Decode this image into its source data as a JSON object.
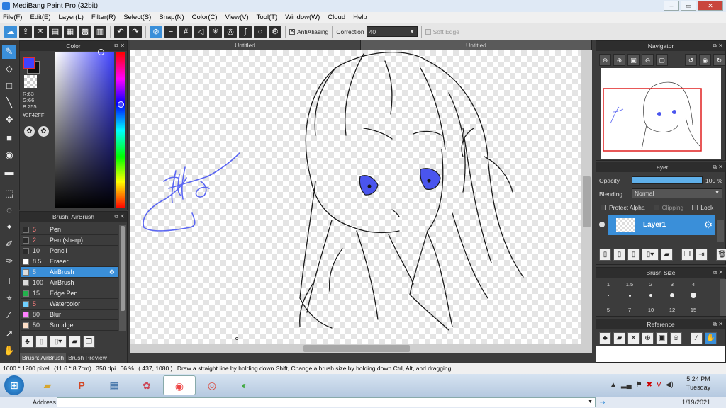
{
  "window": {
    "title": "MediBang Paint Pro (32bit)",
    "minimize": "–",
    "maximize": "▭",
    "close": "✕"
  },
  "menu": [
    "File(F)",
    "Edit(E)",
    "Layer(L)",
    "Filter(R)",
    "Select(S)",
    "Snap(N)",
    "Color(C)",
    "View(V)",
    "Tool(T)",
    "Window(W)",
    "Cloud",
    "Help"
  ],
  "toolbar": {
    "antialiasing": "AntiAliasing",
    "correction_label": "Correction",
    "correction_value": "40",
    "soft_edge": "Soft Edge"
  },
  "color_panel": {
    "title": "Color",
    "r": "R:63",
    "g": "G:66",
    "b": "B:255",
    "hex": "#3F42FF",
    "main_color": "#3F42FF"
  },
  "brush_panel": {
    "title": "Brush: AirBrush",
    "brushes": [
      {
        "size": "5",
        "name": "Pen",
        "swatch": "#2b2b2b",
        "selected": false
      },
      {
        "size": "2",
        "name": "Pen (sharp)",
        "swatch": "#2b2b2b",
        "selected": false
      },
      {
        "size": "10",
        "name": "Pencil",
        "swatch": "#2b2b2b",
        "selected": false
      },
      {
        "size": "8.5",
        "name": "Eraser",
        "swatch": "#ffffff",
        "selected": false
      },
      {
        "size": "5",
        "name": "AirBrush",
        "swatch": "#dddddd",
        "selected": true
      },
      {
        "size": "100",
        "name": "AirBrush",
        "swatch": "#dddddd",
        "selected": false
      },
      {
        "size": "15",
        "name": "Edge Pen",
        "swatch": "#22b14c",
        "selected": false
      },
      {
        "size": "5",
        "name": "Watercolor",
        "swatch": "#6fd0ff",
        "selected": false
      },
      {
        "size": "80",
        "name": "Blur",
        "swatch": "#ff80ff",
        "selected": false
      },
      {
        "size": "50",
        "name": "Smudge",
        "swatch": "#ffe0c8",
        "selected": false
      }
    ],
    "tab_active": "Brush: AirBrush",
    "tab_inactive": "Brush Preview"
  },
  "tabs": [
    "Untitled",
    "Untitled"
  ],
  "navigator": {
    "title": "Navigator"
  },
  "layer_panel": {
    "title": "Layer",
    "opacity_label": "Opacity",
    "opacity_value": "100 %",
    "opacity": 1.0,
    "blending_label": "Blending",
    "blending_value": "Normal",
    "protect_alpha": "Protect Alpha",
    "clipping": "Clipping",
    "lock": "Lock",
    "layer_name": "Layer1"
  },
  "brush_size": {
    "title": "Brush Size",
    "sizes": [
      "1",
      "1.5",
      "2",
      "3",
      "4",
      "5",
      "7",
      "10",
      "12",
      "15"
    ]
  },
  "reference": {
    "title": "Reference"
  },
  "statusbar": {
    "dims": "1600 * 1200 pixel",
    "cm": "(11.6 * 8.7cm)",
    "dpi": "350 dpi",
    "zoom": "66 %",
    "coords": "( 437, 1080 )",
    "hint": "Draw a straight line by holding down Shift, Change a brush size by holding down Ctrl, Alt, and dragging"
  },
  "taskbar": {
    "time": "5:24 PM",
    "day": "Tuesday",
    "date": "1/19/2021",
    "address_label": "Address"
  }
}
